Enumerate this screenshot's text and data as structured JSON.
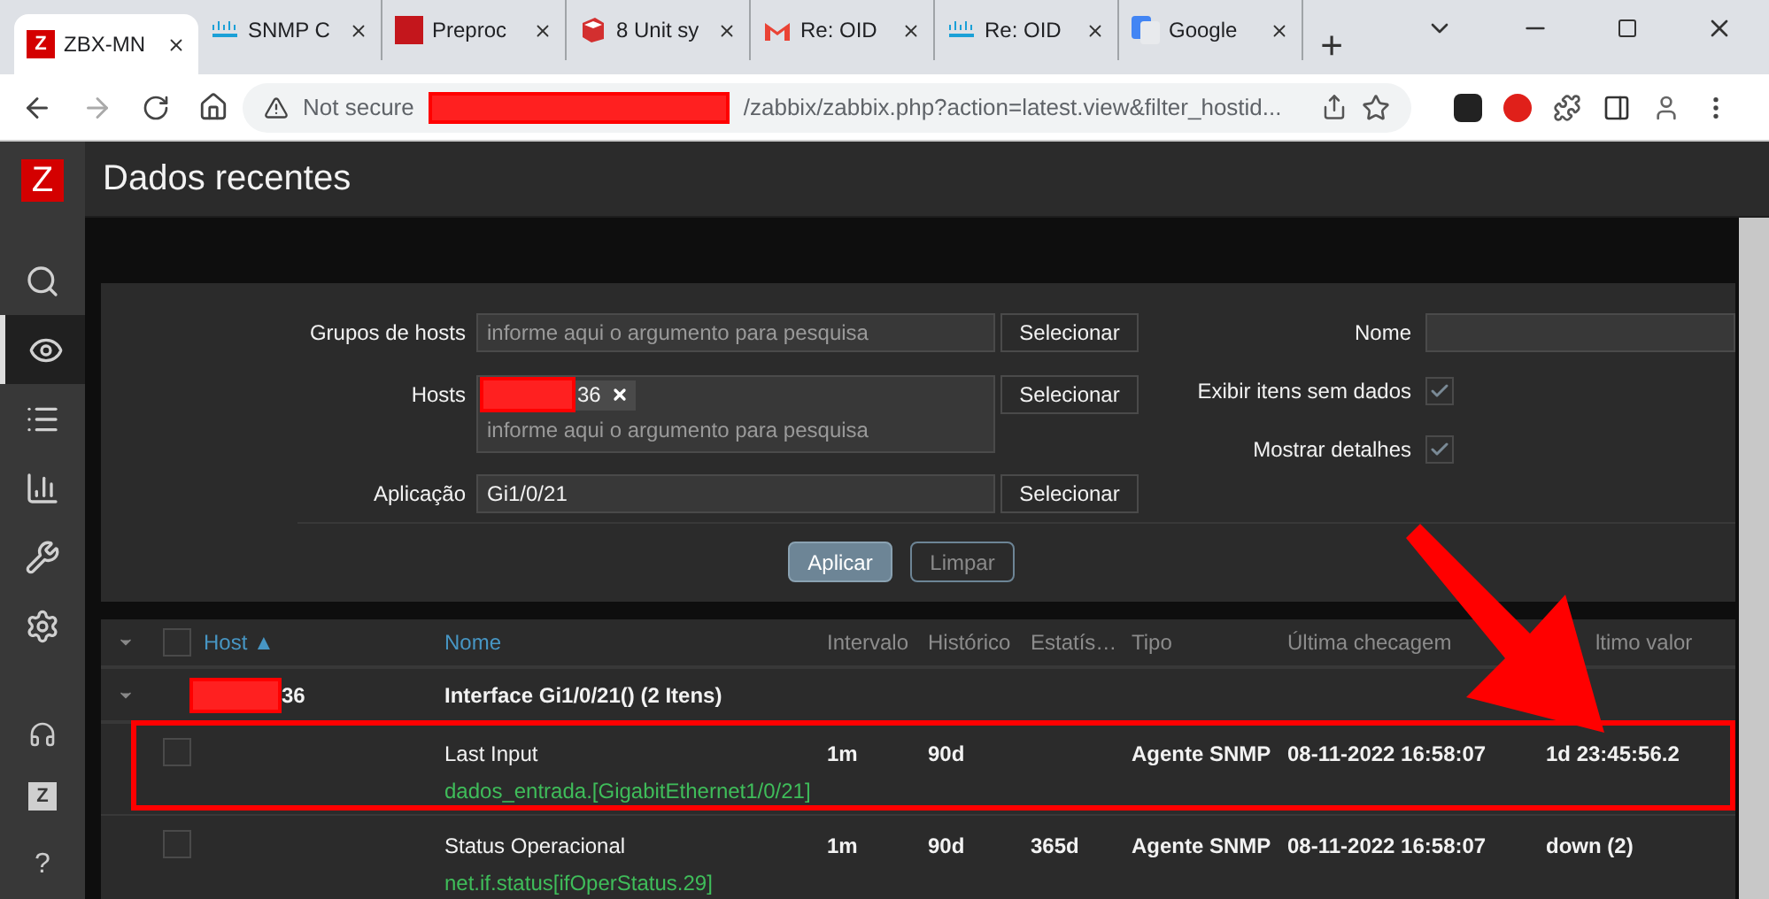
{
  "browser": {
    "tabs": [
      {
        "title": "ZBX-MN",
        "selected": true
      },
      {
        "title": "SNMP C",
        "selected": false
      },
      {
        "title": "Preproc",
        "selected": false
      },
      {
        "title": "8 Unit sy",
        "selected": false
      },
      {
        "title": "Re: OID",
        "selected": false
      },
      {
        "title": "Re: OID",
        "selected": false
      },
      {
        "title": "Google",
        "selected": false
      }
    ],
    "new_tab": "+",
    "tab_logo": "Z",
    "security": "Not secure",
    "url": "/zabbix/zabbix.php?action=latest.view&filter_hostid..."
  },
  "sidebar": {
    "logo": "Z",
    "items": [
      {
        "selected": false
      },
      {
        "selected": true
      },
      {
        "selected": false
      },
      {
        "selected": false
      },
      {
        "selected": false
      },
      {
        "selected": false
      }
    ],
    "bottom": [
      {
        "kind": "support"
      },
      {
        "kind": "share",
        "label": "Z"
      },
      {
        "kind": "help",
        "label": "?"
      }
    ]
  },
  "page": {
    "title": "Dados recentes"
  },
  "filter": {
    "host_groups": {
      "label": "Grupos de hosts",
      "placeholder": "informe aqui o argumento para pesquisa",
      "button": "Selecionar"
    },
    "hosts": {
      "label": "Hosts",
      "chip": "36",
      "placeholder": "informe aqui o argumento para pesquisa",
      "button": "Selecionar"
    },
    "application": {
      "label": "Aplicação",
      "value": "Gi1/0/21",
      "button": "Selecionar"
    },
    "name": {
      "label": "Nome"
    },
    "options": [
      {
        "label": "Exibir itens sem dados",
        "checked": true
      },
      {
        "label": "Mostrar detalhes",
        "checked": true
      }
    ],
    "apply": "Aplicar",
    "reset": "Limpar"
  },
  "table": {
    "expanded": true,
    "all_checked": false,
    "columns": [
      "Host ▲",
      "Nome",
      "Intervalo",
      "Histórico",
      "Estatís…",
      "Tipo",
      "Última checagem",
      "ltimo valor"
    ],
    "group": {
      "host": "36",
      "name": "Interface Gi1/0/21() (2 Itens)",
      "expanded": true
    },
    "rows": [
      {
        "name": "Last Input",
        "key": "dados_entrada.[GigabitEthernet1/0/21]",
        "interval": "1m",
        "history": "90d",
        "trends": "",
        "type": "Agente SNMP",
        "last_check": "08-11-2022 16:58:07",
        "last_value": "1d 23:45:56.2",
        "checked": false,
        "highlighted": true
      },
      {
        "name": "Status Operacional",
        "key": "net.if.status[ifOperStatus.29]",
        "interval": "1m",
        "history": "90d",
        "trends": "365d",
        "type": "Agente SNMP",
        "last_check": "08-11-2022 16:58:07",
        "last_value": "down (2)",
        "checked": false,
        "highlighted": false
      }
    ]
  }
}
